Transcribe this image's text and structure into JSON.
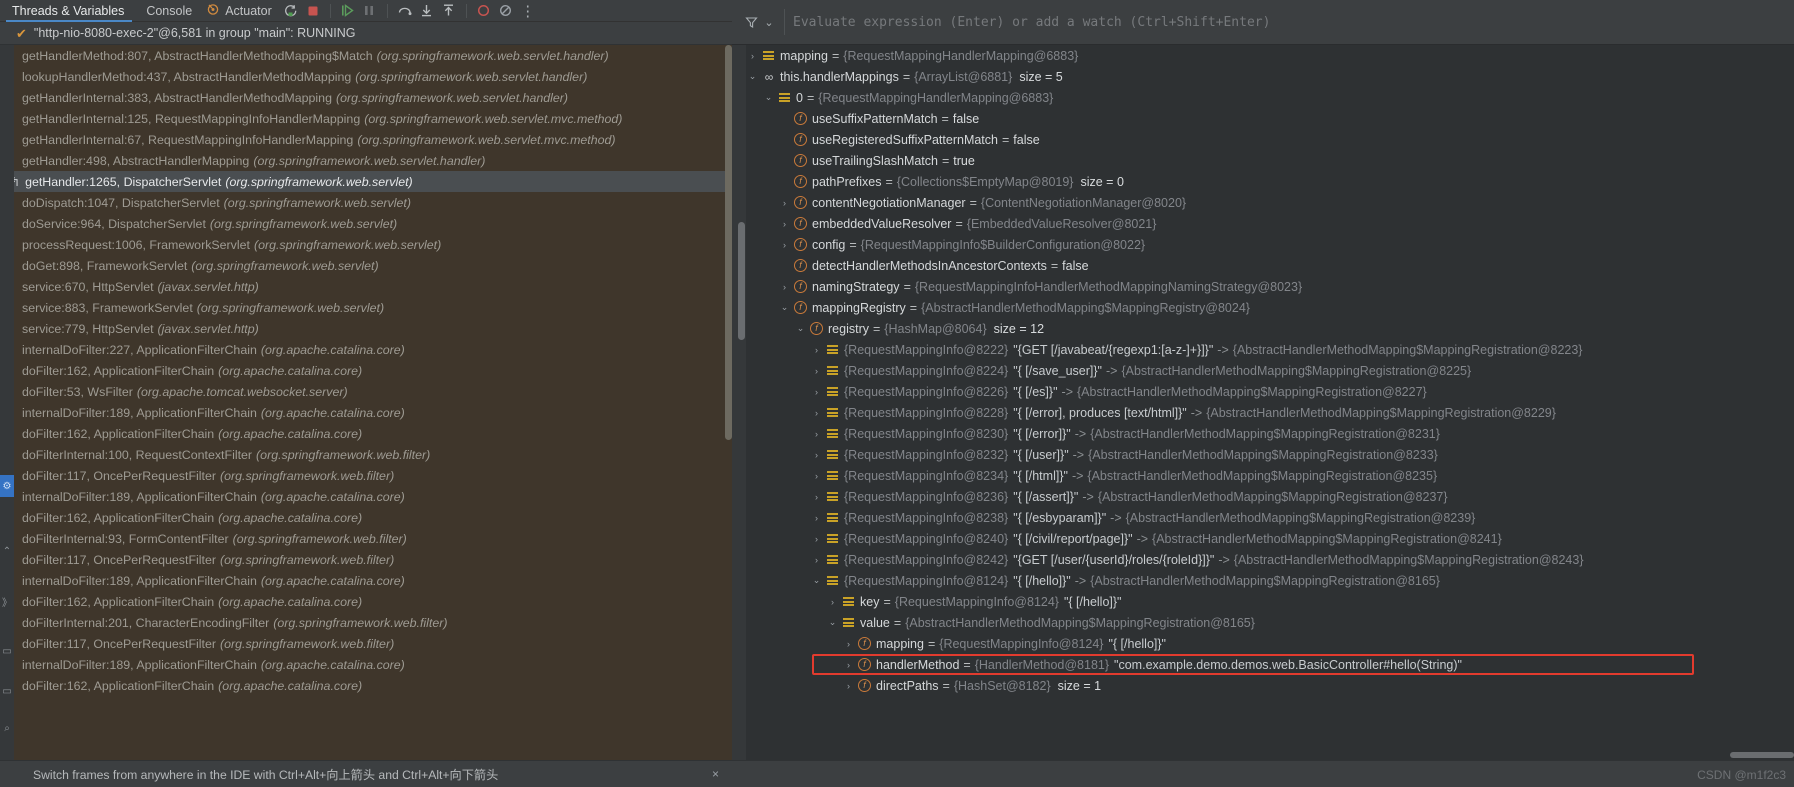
{
  "toolbar": {
    "tabs": [
      {
        "label": "Threads & Variables",
        "active": true
      },
      {
        "label": "Console",
        "active": false
      }
    ],
    "actuator_label": "Actuator",
    "actuator_icon": "actuator-icon",
    "buttons": [
      {
        "name": "rerun-icon",
        "title": "Rerun"
      },
      {
        "name": "stop-icon",
        "title": "Stop"
      },
      {
        "name": "resume-program-icon",
        "title": "Resume Program"
      },
      {
        "name": "pause-program-icon",
        "title": "Pause Program"
      },
      {
        "name": "step-over-icon",
        "title": "Step Over"
      },
      {
        "name": "step-into-icon",
        "title": "Step Into"
      },
      {
        "name": "step-out-icon",
        "title": "Step Out"
      },
      {
        "name": "view-breakpoints-icon",
        "title": "View Breakpoints"
      },
      {
        "name": "mute-breakpoints-icon",
        "title": "Mute Breakpoints"
      },
      {
        "name": "more-options-icon",
        "title": "More"
      }
    ]
  },
  "thread": {
    "status_icon": "check-icon",
    "text": "\"http-nio-8080-exec-2\"@6,581 in group \"main\": RUNNING"
  },
  "frames": {
    "rows": [
      {
        "name": "getHandlerMethod:807, AbstractHandlerMethodMapping$Match",
        "pkg": "(org.springframework.web.servlet.handler)",
        "selected": false
      },
      {
        "name": "lookupHandlerMethod:437, AbstractHandlerMethodMapping",
        "pkg": "(org.springframework.web.servlet.handler)",
        "selected": false
      },
      {
        "name": "getHandlerInternal:383, AbstractHandlerMethodMapping",
        "pkg": "(org.springframework.web.servlet.handler)",
        "selected": false
      },
      {
        "name": "getHandlerInternal:125, RequestMappingInfoHandlerMapping",
        "pkg": "(org.springframework.web.servlet.mvc.method)",
        "selected": false
      },
      {
        "name": "getHandlerInternal:67, RequestMappingInfoHandlerMapping",
        "pkg": "(org.springframework.web.servlet.mvc.method)",
        "selected": false
      },
      {
        "name": "getHandler:498, AbstractHandlerMapping",
        "pkg": "(org.springframework.web.servlet.handler)",
        "selected": false
      },
      {
        "name": "getHandler:1265, DispatcherServlet",
        "pkg": "(org.springframework.web.servlet)",
        "selected": true
      },
      {
        "name": "doDispatch:1047, DispatcherServlet",
        "pkg": "(org.springframework.web.servlet)",
        "selected": false
      },
      {
        "name": "doService:964, DispatcherServlet",
        "pkg": "(org.springframework.web.servlet)",
        "selected": false
      },
      {
        "name": "processRequest:1006, FrameworkServlet",
        "pkg": "(org.springframework.web.servlet)",
        "selected": false
      },
      {
        "name": "doGet:898, FrameworkServlet",
        "pkg": "(org.springframework.web.servlet)",
        "selected": false
      },
      {
        "name": "service:670, HttpServlet",
        "pkg": "(javax.servlet.http)",
        "selected": false
      },
      {
        "name": "service:883, FrameworkServlet",
        "pkg": "(org.springframework.web.servlet)",
        "selected": false
      },
      {
        "name": "service:779, HttpServlet",
        "pkg": "(javax.servlet.http)",
        "selected": false
      },
      {
        "name": "internalDoFilter:227, ApplicationFilterChain",
        "pkg": "(org.apache.catalina.core)",
        "selected": false
      },
      {
        "name": "doFilter:162, ApplicationFilterChain",
        "pkg": "(org.apache.catalina.core)",
        "selected": false
      },
      {
        "name": "doFilter:53, WsFilter",
        "pkg": "(org.apache.tomcat.websocket.server)",
        "selected": false
      },
      {
        "name": "internalDoFilter:189, ApplicationFilterChain",
        "pkg": "(org.apache.catalina.core)",
        "selected": false
      },
      {
        "name": "doFilter:162, ApplicationFilterChain",
        "pkg": "(org.apache.catalina.core)",
        "selected": false
      },
      {
        "name": "doFilterInternal:100, RequestContextFilter",
        "pkg": "(org.springframework.web.filter)",
        "selected": false
      },
      {
        "name": "doFilter:117, OncePerRequestFilter",
        "pkg": "(org.springframework.web.filter)",
        "selected": false
      },
      {
        "name": "internalDoFilter:189, ApplicationFilterChain",
        "pkg": "(org.apache.catalina.core)",
        "selected": false
      },
      {
        "name": "doFilter:162, ApplicationFilterChain",
        "pkg": "(org.apache.catalina.core)",
        "selected": false
      },
      {
        "name": "doFilterInternal:93, FormContentFilter",
        "pkg": "(org.springframework.web.filter)",
        "selected": false
      },
      {
        "name": "doFilter:117, OncePerRequestFilter",
        "pkg": "(org.springframework.web.filter)",
        "selected": false
      },
      {
        "name": "internalDoFilter:189, ApplicationFilterChain",
        "pkg": "(org.apache.catalina.core)",
        "selected": false
      },
      {
        "name": "doFilter:162, ApplicationFilterChain",
        "pkg": "(org.apache.catalina.core)",
        "selected": false
      },
      {
        "name": "doFilterInternal:201, CharacterEncodingFilter",
        "pkg": "(org.springframework.web.filter)",
        "selected": false
      },
      {
        "name": "doFilter:117, OncePerRequestFilter",
        "pkg": "(org.springframework.web.filter)",
        "selected": false
      },
      {
        "name": "internalDoFilter:189, ApplicationFilterChain",
        "pkg": "(org.apache.catalina.core)",
        "selected": false
      },
      {
        "name": "doFilter:162, ApplicationFilterChain",
        "pkg": "(org.apache.catalina.core)",
        "selected": false
      }
    ]
  },
  "hint": {
    "text": "Switch frames from anywhere in the IDE with Ctrl+Alt+向上箭头 and Ctrl+Alt+向下箭头",
    "close_label": "×"
  },
  "evaluate": {
    "placeholder": "Evaluate expression (Enter) or add a watch (Ctrl+Shift+Enter)",
    "filter_icon": "filter-icon",
    "chevron_icon": "chevron-down-icon"
  },
  "variables": {
    "rows": [
      {
        "indent": 0,
        "arrow": "collapsed",
        "icon": "list-icon",
        "name": "mapping",
        "eq": "=",
        "value": "{RequestMappingHandlerMapping@6883}"
      },
      {
        "indent": 0,
        "arrow": "expanded",
        "icon": "oo-icon",
        "name": "this.handlerMappings",
        "eq": "=",
        "value": "{ArrayList@6881}",
        "size_label": "size = 5"
      },
      {
        "indent": 1,
        "arrow": "expanded",
        "icon": "list-icon",
        "name": "0",
        "eq": "=",
        "value": "{RequestMappingHandlerMapping@6883}"
      },
      {
        "indent": 2,
        "arrow": "none",
        "icon": "field-icon",
        "name": "useSuffixPatternMatch",
        "eq": "=",
        "bool": "false"
      },
      {
        "indent": 2,
        "arrow": "none",
        "icon": "field-icon",
        "name": "useRegisteredSuffixPatternMatch",
        "eq": "=",
        "bool": "false"
      },
      {
        "indent": 2,
        "arrow": "none",
        "icon": "field-icon",
        "name": "useTrailingSlashMatch",
        "eq": "=",
        "bool": "true"
      },
      {
        "indent": 2,
        "arrow": "none",
        "icon": "field-icon",
        "name": "pathPrefixes",
        "eq": "=",
        "value": "{Collections$EmptyMap@8019}",
        "size_label": "size = 0"
      },
      {
        "indent": 2,
        "arrow": "collapsed",
        "icon": "field-icon",
        "name": "contentNegotiationManager",
        "eq": "=",
        "value": "{ContentNegotiationManager@8020}"
      },
      {
        "indent": 2,
        "arrow": "collapsed",
        "icon": "field-icon",
        "name": "embeddedValueResolver",
        "eq": "=",
        "value": "{EmbeddedValueResolver@8021}"
      },
      {
        "indent": 2,
        "arrow": "collapsed",
        "icon": "field-icon",
        "name": "config",
        "eq": "=",
        "value": "{RequestMappingInfo$BuilderConfiguration@8022}"
      },
      {
        "indent": 2,
        "arrow": "none",
        "icon": "field-icon",
        "name": "detectHandlerMethodsInAncestorContexts",
        "eq": "=",
        "bool": "false"
      },
      {
        "indent": 2,
        "arrow": "collapsed",
        "icon": "field-icon",
        "name": "namingStrategy",
        "eq": "=",
        "value": "{RequestMappingInfoHandlerMethodMappingNamingStrategy@8023}"
      },
      {
        "indent": 2,
        "arrow": "expanded",
        "icon": "field-icon",
        "name": "mappingRegistry",
        "eq": "=",
        "value": "{AbstractHandlerMethodMapping$MappingRegistry@8024}"
      },
      {
        "indent": 3,
        "arrow": "expanded",
        "icon": "field-icon",
        "name": "registry",
        "eq": "=",
        "value": "{HashMap@8064}",
        "size_label": "size = 12"
      },
      {
        "indent": 4,
        "arrow": "collapsed",
        "icon": "list-icon",
        "value": "{RequestMappingInfo@8222}",
        "str": "\"{GET [/javabeat/{regexp1:[a-z-]+}]}\"",
        "arrowsep": "->",
        "value2": "{AbstractHandlerMethodMapping$MappingRegistration@8223}"
      },
      {
        "indent": 4,
        "arrow": "collapsed",
        "icon": "list-icon",
        "value": "{RequestMappingInfo@8224}",
        "str": "\"{ [/save_user]}\"",
        "arrowsep": "->",
        "value2": "{AbstractHandlerMethodMapping$MappingRegistration@8225}"
      },
      {
        "indent": 4,
        "arrow": "collapsed",
        "icon": "list-icon",
        "value": "{RequestMappingInfo@8226}",
        "str": "\"{ [/es]}\"",
        "arrowsep": "->",
        "value2": "{AbstractHandlerMethodMapping$MappingRegistration@8227}"
      },
      {
        "indent": 4,
        "arrow": "collapsed",
        "icon": "list-icon",
        "value": "{RequestMappingInfo@8228}",
        "str": "\"{ [/error], produces [text/html]}\"",
        "arrowsep": "->",
        "value2": "{AbstractHandlerMethodMapping$MappingRegistration@8229}"
      },
      {
        "indent": 4,
        "arrow": "collapsed",
        "icon": "list-icon",
        "value": "{RequestMappingInfo@8230}",
        "str": "\"{ [/error]}\"",
        "arrowsep": "->",
        "value2": "{AbstractHandlerMethodMapping$MappingRegistration@8231}"
      },
      {
        "indent": 4,
        "arrow": "collapsed",
        "icon": "list-icon",
        "value": "{RequestMappingInfo@8232}",
        "str": "\"{ [/user]}\"",
        "arrowsep": "->",
        "value2": "{AbstractHandlerMethodMapping$MappingRegistration@8233}"
      },
      {
        "indent": 4,
        "arrow": "collapsed",
        "icon": "list-icon",
        "value": "{RequestMappingInfo@8234}",
        "str": "\"{ [/html]}\"",
        "arrowsep": "->",
        "value2": "{AbstractHandlerMethodMapping$MappingRegistration@8235}"
      },
      {
        "indent": 4,
        "arrow": "collapsed",
        "icon": "list-icon",
        "value": "{RequestMappingInfo@8236}",
        "str": "\"{ [/assert]}\"",
        "arrowsep": "->",
        "value2": "{AbstractHandlerMethodMapping$MappingRegistration@8237}"
      },
      {
        "indent": 4,
        "arrow": "collapsed",
        "icon": "list-icon",
        "value": "{RequestMappingInfo@8238}",
        "str": "\"{ [/esbyparam]}\"",
        "arrowsep": "->",
        "value2": "{AbstractHandlerMethodMapping$MappingRegistration@8239}"
      },
      {
        "indent": 4,
        "arrow": "collapsed",
        "icon": "list-icon",
        "value": "{RequestMappingInfo@8240}",
        "str": "\"{ [/civil/report/page]}\"",
        "arrowsep": "->",
        "value2": "{AbstractHandlerMethodMapping$MappingRegistration@8241}"
      },
      {
        "indent": 4,
        "arrow": "collapsed",
        "icon": "list-icon",
        "value": "{RequestMappingInfo@8242}",
        "str": "\"{GET [/user/{userId}/roles/{roleId}]}\"",
        "arrowsep": "->",
        "value2": "{AbstractHandlerMethodMapping$MappingRegistration@8243}"
      },
      {
        "indent": 4,
        "arrow": "expanded",
        "icon": "list-icon",
        "value": "{RequestMappingInfo@8124}",
        "str": "\"{ [/hello]}\"",
        "arrowsep": "->",
        "value2": "{AbstractHandlerMethodMapping$MappingRegistration@8165}"
      },
      {
        "indent": 5,
        "arrow": "collapsed",
        "icon": "list-icon",
        "name": "key",
        "eq": "=",
        "value": "{RequestMappingInfo@8124}",
        "str": "\"{ [/hello]}\""
      },
      {
        "indent": 5,
        "arrow": "expanded",
        "icon": "list-icon",
        "name": "value",
        "eq": "=",
        "value": "{AbstractHandlerMethodMapping$MappingRegistration@8165}"
      },
      {
        "indent": 6,
        "arrow": "collapsed",
        "icon": "field-icon",
        "name": "mapping",
        "eq": "=",
        "value": "{RequestMappingInfo@8124}",
        "str": "\"{ [/hello]}\""
      },
      {
        "indent": 6,
        "arrow": "collapsed",
        "icon": "field-icon",
        "name": "handlerMethod",
        "eq": "=",
        "value": "{HandlerMethod@8181}",
        "str": "\"com.example.demo.demos.web.BasicController#hello(String)\"",
        "highlight": true
      },
      {
        "indent": 6,
        "arrow": "collapsed",
        "icon": "field-icon",
        "name": "directPaths",
        "eq": "=",
        "value": "{HashSet@8182}",
        "size_label": "size = 1"
      }
    ]
  },
  "watermark": "CSDN @m1f2c3",
  "colors": {
    "accent": "#4a88c7",
    "frames_bg": "#3f362b",
    "panel_bg": "#2e3133",
    "toolbar_bg": "#3c3f41",
    "highlight_border": "#e23b2e",
    "field_icon": "#d38c4c",
    "list_icon": "#c9a227",
    "string_value": "#c8cccf",
    "object_ref": "#82858a"
  }
}
